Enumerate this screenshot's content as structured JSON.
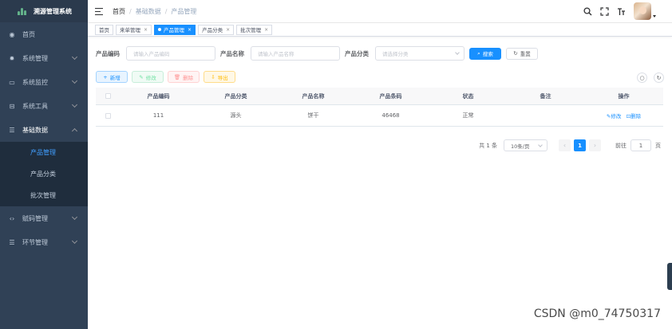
{
  "app": {
    "title": "溯源管理系统"
  },
  "sidebar": {
    "items": [
      {
        "label": "首页",
        "icon": "dashboard-icon"
      },
      {
        "label": "系统管理",
        "icon": "gear-icon"
      },
      {
        "label": "系统监控",
        "icon": "monitor-icon"
      },
      {
        "label": "系统工具",
        "icon": "toolbox-icon"
      },
      {
        "label": "基础数据",
        "icon": "list-icon"
      },
      {
        "label": "赋码管理",
        "icon": "code-icon"
      },
      {
        "label": "环节管理",
        "icon": "list-icon"
      }
    ],
    "sub_items": [
      {
        "label": "产品管理"
      },
      {
        "label": "产品分类"
      },
      {
        "label": "批次管理"
      }
    ]
  },
  "breadcrumb": {
    "home": "首页",
    "mid": "基础数据",
    "current": "产品管理",
    "separator": "/"
  },
  "tags": [
    {
      "label": "首页"
    },
    {
      "label": "来单管理"
    },
    {
      "label": "产品管理"
    },
    {
      "label": "产品分类"
    },
    {
      "label": "批次管理"
    }
  ],
  "search": {
    "code_label": "产品编码",
    "code_placeholder": "请输入产品编码",
    "name_label": "产品名称",
    "name_placeholder": "请输入产品名称",
    "category_label": "产品分类",
    "category_placeholder": "请选择分类",
    "search_button": "搜索",
    "reset_button": "重置"
  },
  "toolbar": {
    "add": "新增",
    "edit": "修改",
    "delete": "删除",
    "export": "导出"
  },
  "table": {
    "columns": [
      "产品编码",
      "产品分类",
      "产品名称",
      "产品条码",
      "状态",
      "备注",
      "操作"
    ],
    "rows": [
      {
        "code": "111",
        "category": "源头",
        "name": "饼干",
        "barcode": "46468",
        "status": "正常",
        "remark": "",
        "edit": "修改",
        "delete": "删除"
      }
    ]
  },
  "pagination": {
    "total": "共 1 条",
    "page_size": "10条/页",
    "current_page": "1",
    "goto": "前往",
    "goto_value": "1",
    "page_unit": "页"
  },
  "watermark": "CSDN @m0_74750317",
  "colors": {
    "sidebar_bg": "#304156",
    "primary": "#1890ff",
    "sidebar_active_text": "#409eff"
  }
}
